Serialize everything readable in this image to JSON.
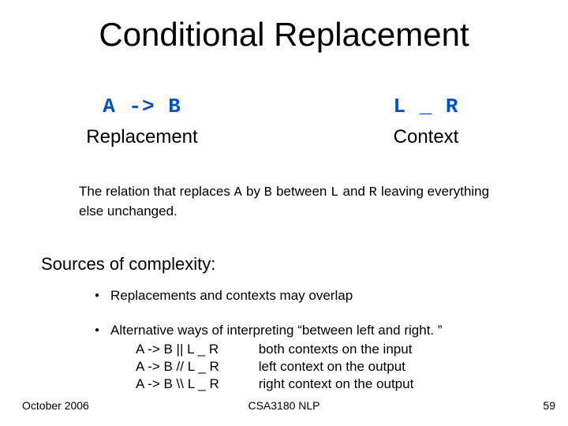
{
  "title": "Conditional Replacement",
  "left": {
    "code": "A -> B",
    "label": "Replacement"
  },
  "right": {
    "code": "L _ R",
    "label": "Context"
  },
  "relation": {
    "pre": "The relation that replaces ",
    "A": "A",
    "mid1": " by ",
    "B": "B",
    "mid2": " between ",
    "L": "L",
    "mid3": " and ",
    "R": "R",
    "post": " leaving everything else unchanged."
  },
  "sources_heading": "Sources of complexity:",
  "bullets": [
    {
      "text": "Replacements and contexts may overlap"
    }
  ],
  "alt": {
    "lead": "Alternative ways of interpreting “between left and right. ”",
    "rows": [
      {
        "expr": "A -> B || L _ R",
        "desc": "both contexts on the input"
      },
      {
        "expr": "A -> B // L _ R",
        "desc": "left context on the output"
      },
      {
        "expr": "A -> B \\\\ L _ R",
        "desc": "right context on the output"
      }
    ]
  },
  "footer": {
    "left": "October 2006",
    "mid": "CSA3180 NLP",
    "right": "59"
  }
}
